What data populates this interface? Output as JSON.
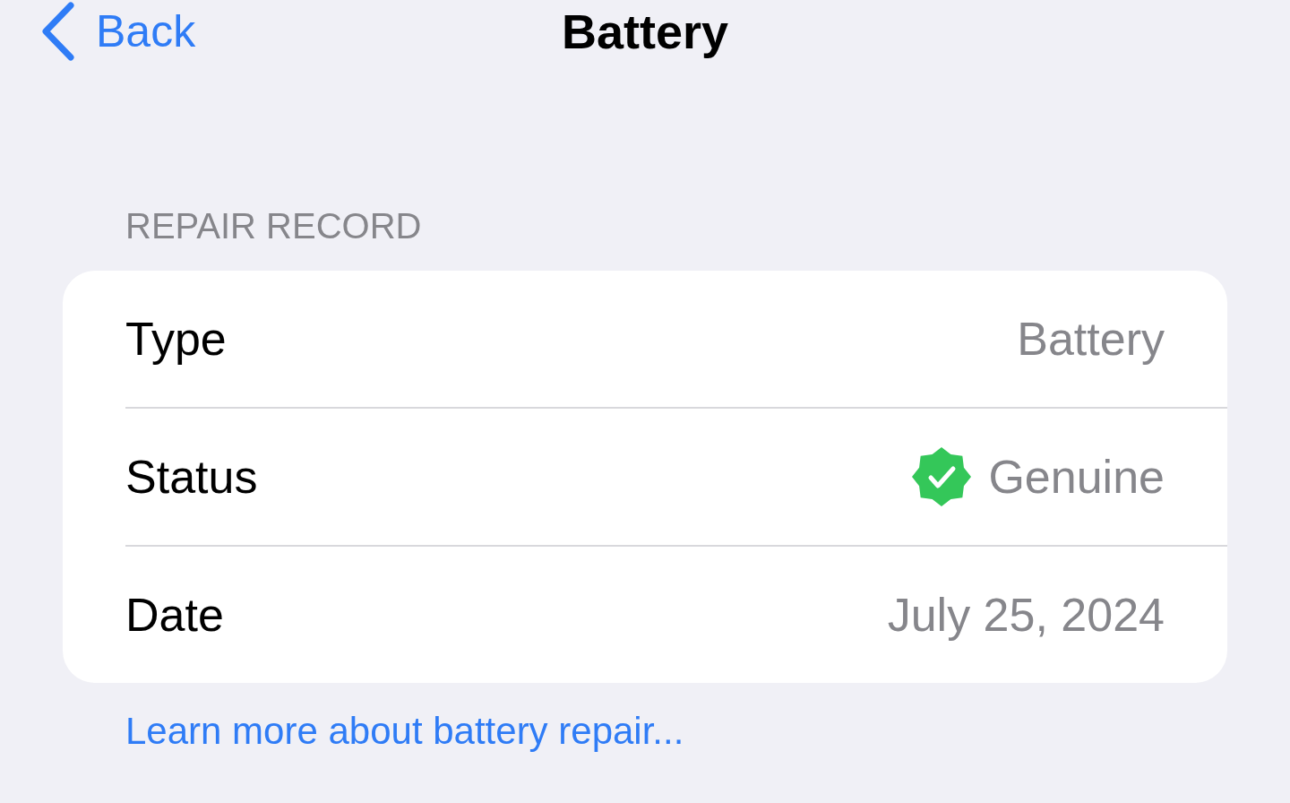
{
  "nav": {
    "back": "Back",
    "title": "Battery"
  },
  "section": {
    "header": "REPAIR RECORD",
    "rows": [
      {
        "label": "Type",
        "value": "Battery",
        "verified": false
      },
      {
        "label": "Status",
        "value": "Genuine",
        "verified": true
      },
      {
        "label": "Date",
        "value": "July 25, 2024",
        "verified": false
      }
    ],
    "footer_link": "Learn more about battery repair..."
  }
}
